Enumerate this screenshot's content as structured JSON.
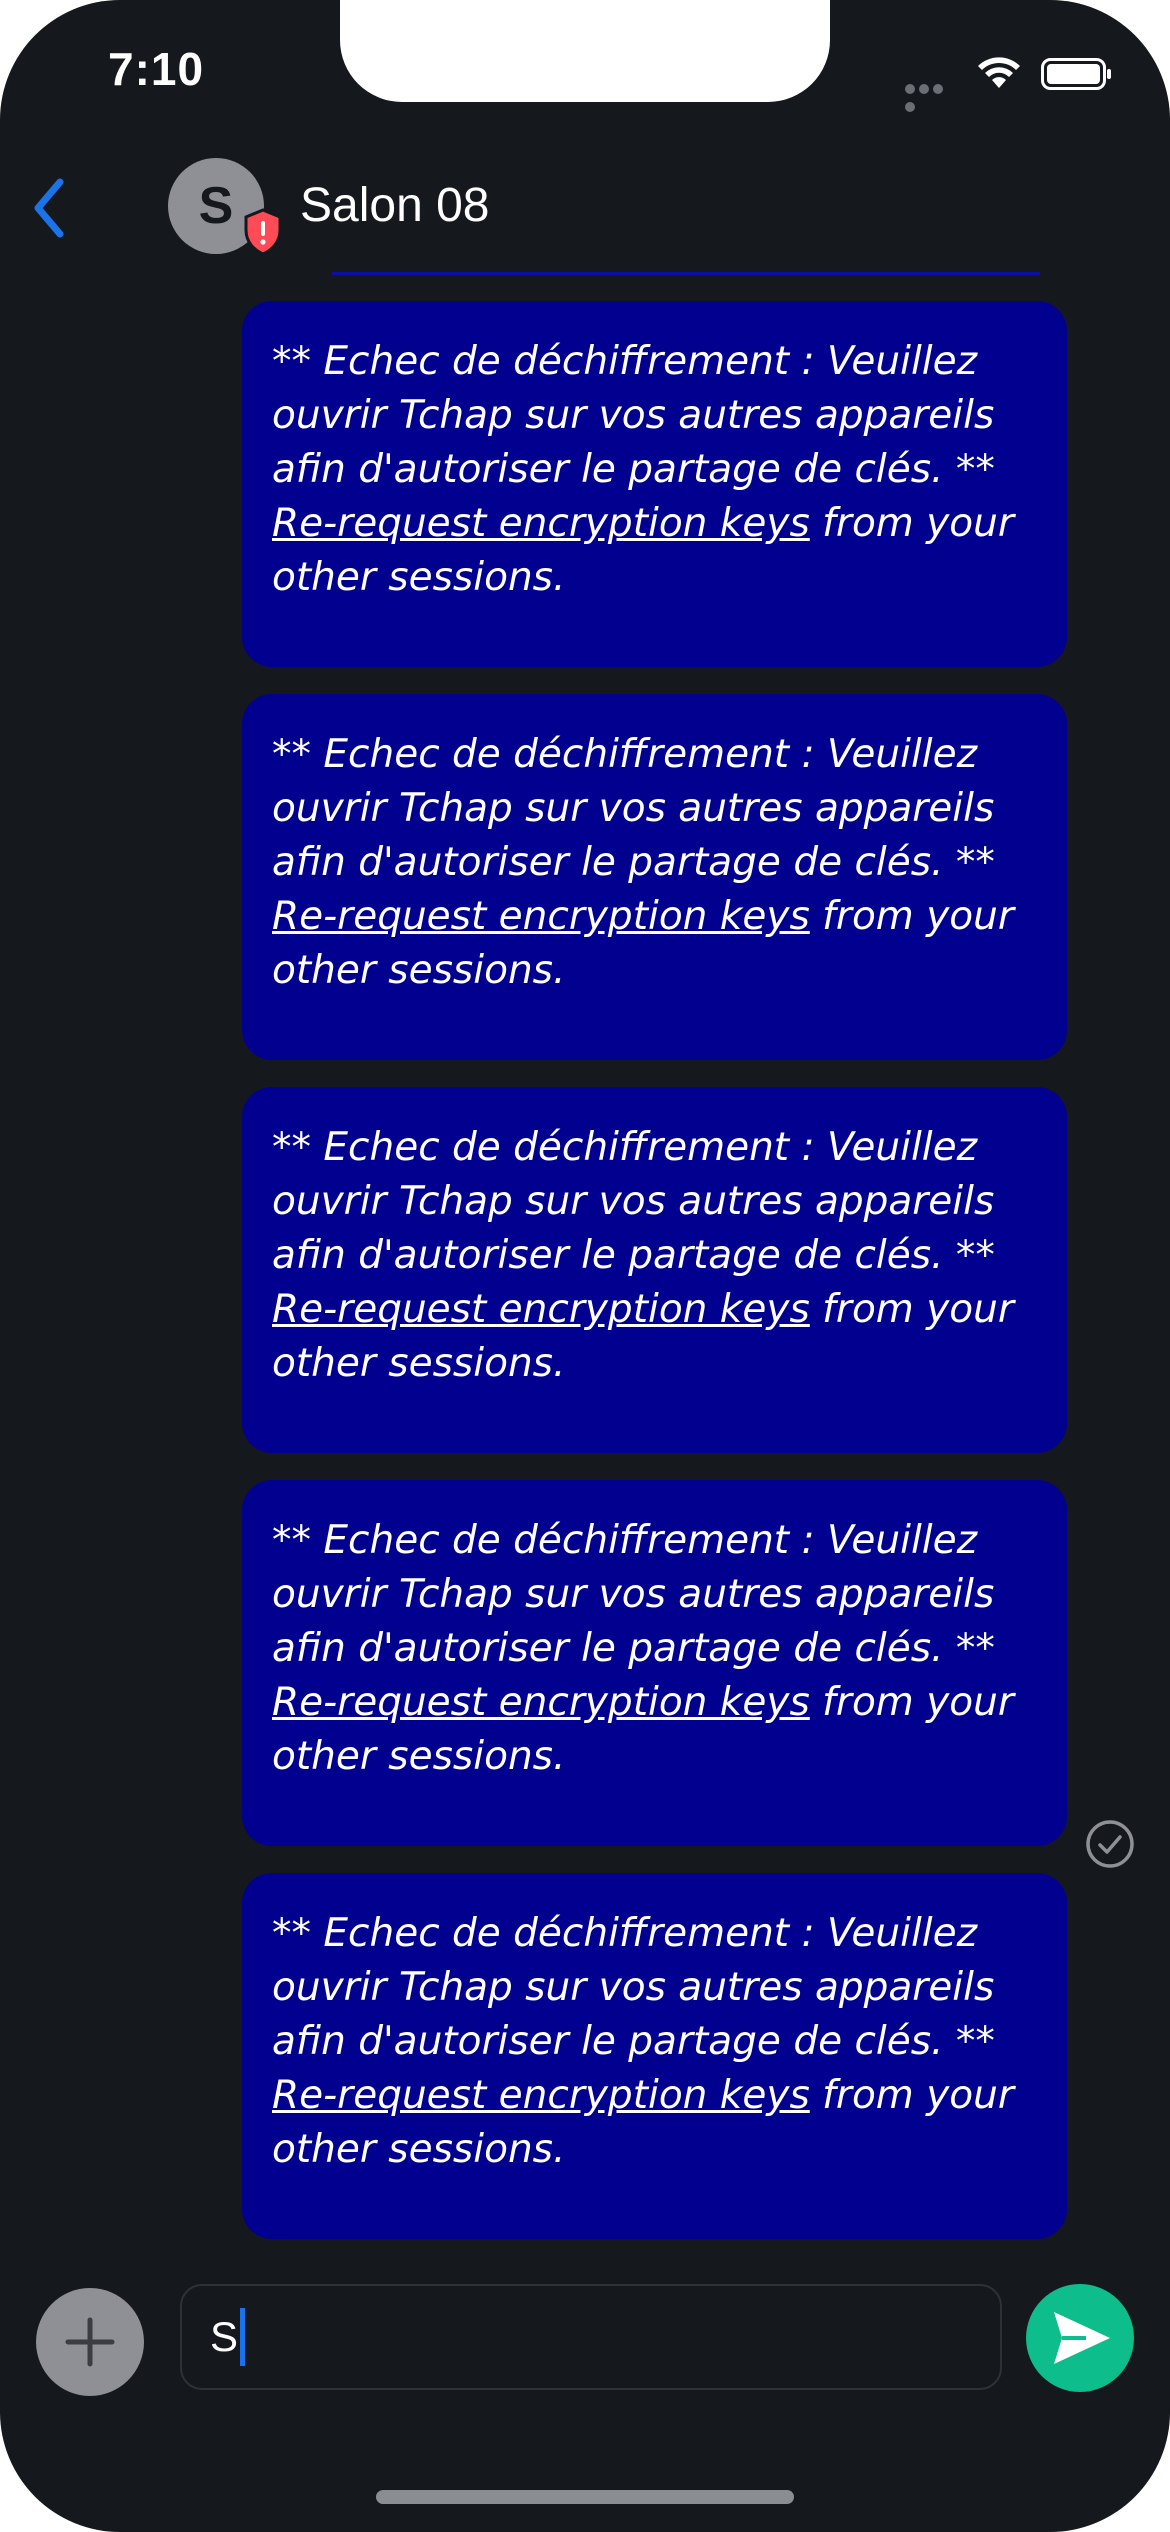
{
  "status_bar": {
    "time": "7:10"
  },
  "header": {
    "avatar_initial": "S",
    "room_name": "Salon 08"
  },
  "messages": [
    {
      "text": "** Echec de déchiffrement : Veuillez ouvrir Tchap sur vos autres appareils afin d'autoriser le partage de clés. **",
      "link_text": "Re-request encryption keys",
      "suffix": " from your other sessions."
    },
    {
      "text": "** Echec de déchiffrement : Veuillez ouvrir Tchap sur vos autres appareils afin d'autoriser le partage de clés. **",
      "link_text": "Re-request encryption keys",
      "suffix": " from your other sessions."
    },
    {
      "text": "** Echec de déchiffrement : Veuillez ouvrir Tchap sur vos autres appareils afin d'autoriser le partage de clés. **",
      "link_text": "Re-request encryption keys",
      "suffix": " from your other sessions."
    },
    {
      "text": "** Echec de déchiffrement : Veuillez ouvrir Tchap sur vos autres appareils afin d'autoriser le partage de clés. **",
      "link_text": "Re-request encryption keys",
      "suffix": " from your other sessions."
    },
    {
      "text": "** Echec de déchiffrement : Veuillez ouvrir Tchap sur vos autres appareils afin d'autoriser le partage de clés. **",
      "link_text": "Re-request encryption keys",
      "suffix": " from your other sessions."
    }
  ],
  "composer": {
    "input_value": "S"
  },
  "icons": {
    "back": "chevron-left-icon",
    "shield": "shield-warning-icon",
    "read_receipt": "check-circle-icon",
    "attach": "plus-icon",
    "send": "send-icon"
  },
  "colors": {
    "background": "#15181d",
    "bubble": "#01008f",
    "accent_blue": "#1a73e8",
    "send_green": "#0dbd8b",
    "shield_red": "#ff4b55"
  }
}
